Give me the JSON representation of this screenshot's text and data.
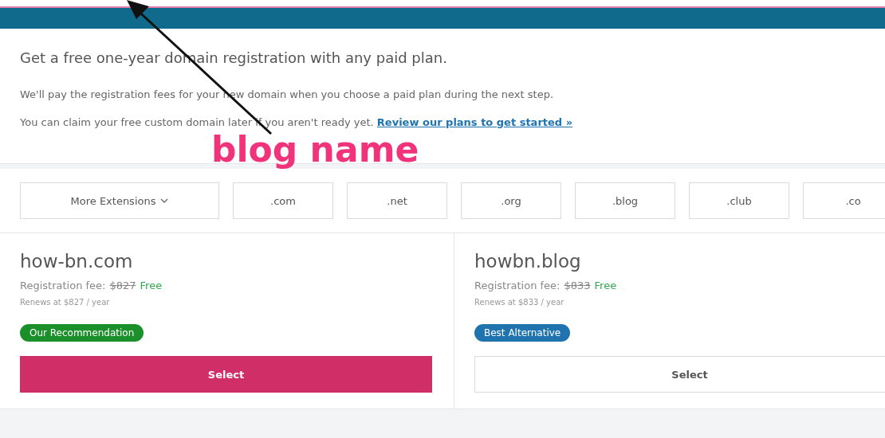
{
  "intro": {
    "heading": "Get a free one-year domain registration with any paid plan.",
    "line_1": "We'll pay the registration fees for your new domain when you choose a paid plan during the next step.",
    "line_2": "You can claim your free custom domain later if you aren't ready yet.",
    "link": "Review our plans to get started »"
  },
  "extensions": [
    {
      "label": "More Extensions",
      "kind": "dropdown"
    },
    {
      "label": ".com",
      "kind": "filter"
    },
    {
      "label": ".net",
      "kind": "filter"
    },
    {
      "label": ".org",
      "kind": "filter"
    },
    {
      "label": ".blog",
      "kind": "filter"
    },
    {
      "label": ".club",
      "kind": "filter"
    },
    {
      "label": ".co",
      "kind": "filter"
    }
  ],
  "results": [
    {
      "domain": "how-bn.com",
      "fee_label": "Registration fee:",
      "fee": "$827",
      "fee_struck": true,
      "free": "Free",
      "renewal": "Renews at $827 / year",
      "badge": "Our Recommendation",
      "color": "#1a8f2a",
      "button": "Select",
      "primary": true
    },
    {
      "domain": "howbn.blog",
      "fee_label": "Registration fee:",
      "fee": "$833",
      "fee_struck": true,
      "free": "Free",
      "renewal": "Renews at $833 / year",
      "badge": "Best Alternative",
      "color": "#1f74b0",
      "button": "Select",
      "primary": false
    }
  ],
  "annotation": {
    "text": "blog name"
  }
}
